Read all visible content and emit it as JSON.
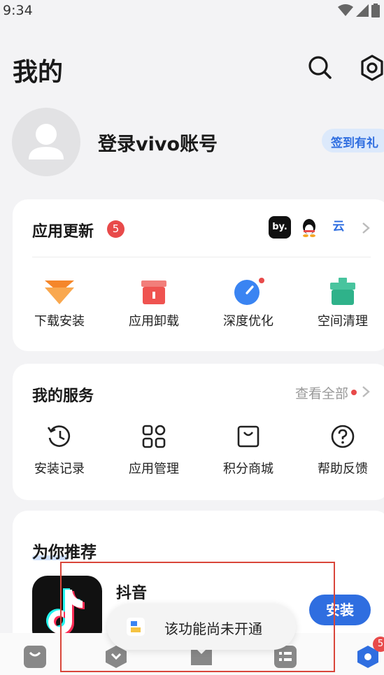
{
  "status_bar": {
    "time": "9:34"
  },
  "header": {
    "title": "我的"
  },
  "profile": {
    "login_label": "登录vivo账号",
    "checkin_label": "签到有礼"
  },
  "updates": {
    "title": "应用更新",
    "count": "5",
    "apps": [
      "by.",
      "QQ",
      "云"
    ],
    "tools": [
      {
        "label": "下载安装",
        "icon": "download-install-icon",
        "color": "#f5862a"
      },
      {
        "label": "应用卸载",
        "icon": "uninstall-icon",
        "color": "#ef5350"
      },
      {
        "label": "深度优化",
        "icon": "optimize-icon",
        "color": "#3a84f2"
      },
      {
        "label": "空间清理",
        "icon": "cleanup-icon",
        "color": "#2fb28a"
      }
    ]
  },
  "services": {
    "title": "我的服务",
    "see_all": "查看全部",
    "items": [
      {
        "label": "安装记录",
        "icon": "history-icon"
      },
      {
        "label": "应用管理",
        "icon": "grid-icon"
      },
      {
        "label": "积分商城",
        "icon": "shop-icon"
      },
      {
        "label": "帮助反馈",
        "icon": "help-icon"
      }
    ]
  },
  "recommend": {
    "title": "为你推荐",
    "app_name": "抖音",
    "install_label": "安装"
  },
  "toast": {
    "message": "该功能尚未开通"
  },
  "bottom_nav": {
    "badge": "5"
  },
  "colors": {
    "accent": "#2f6ee0",
    "badge": "#e84a4a",
    "annotation_box": "#d9463a"
  }
}
